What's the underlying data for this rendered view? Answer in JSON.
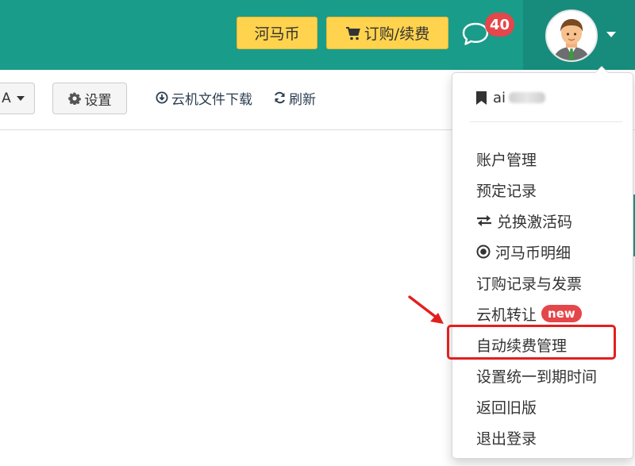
{
  "header": {
    "coin_button": "河马币",
    "order_button": "订购/续费",
    "message_count": "40",
    "accent_color": "#1a9c8b",
    "icons": [
      "cart-icon",
      "chat-bubble-icon",
      "user-avatar",
      "caret-down-icon"
    ]
  },
  "toolbar": {
    "dropdown_label": "A",
    "settings_label": "设置",
    "download_label": "云机文件下载",
    "refresh_label": "刷新",
    "icons": [
      "gear-icon",
      "download-icon",
      "refresh-icon",
      "caret-down-icon"
    ]
  },
  "menu": {
    "user_prefix": "ai",
    "items": [
      {
        "label": "账户管理"
      },
      {
        "label": "预定记录"
      },
      {
        "label": "兑换激活码",
        "icon": "exchange-icon"
      },
      {
        "label": "河马币明细",
        "icon": "target-icon"
      },
      {
        "label": "订购记录与发票"
      },
      {
        "label": "云机转让",
        "badge": "new"
      },
      {
        "label": "自动续费管理",
        "highlighted": true
      },
      {
        "label": "设置统一到期时间"
      },
      {
        "label": "返回旧版"
      },
      {
        "label": "退出登录"
      }
    ]
  },
  "annotation": {
    "highlight_color": "#e21f1f"
  }
}
